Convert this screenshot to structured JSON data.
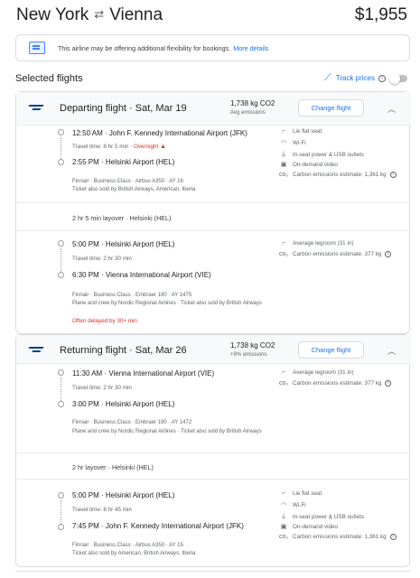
{
  "header": {
    "origin": "New York",
    "swap_glyph": "⇄",
    "destination": "Vienna",
    "total_price": "$1,955"
  },
  "banner": {
    "icon": "flexible-booking-icon",
    "text": "This airline may be offering additional flexibility for bookings.",
    "link": "More details"
  },
  "selected": {
    "title": "Selected flights",
    "track_label": "Track prices",
    "track_enabled": false
  },
  "departing": {
    "title": "Departing flight · Sat, Mar 19",
    "co2": "1,738 kg CO2",
    "co2_sub": "Avg emissions",
    "change_label": "Change flight",
    "segment1": {
      "dep": "12:50 AM · John F. Kennedy International Airport (JFK)",
      "travel": "Travel time: 8 hr 5 min ·",
      "overnight": "Overnight",
      "arr": "2:55 PM · Helsinki Airport (HEL)",
      "info": "Finnair · Business Class · Airbus A350 · AY 16",
      "sold": "Ticket also sold by British Airways, American, Iberia",
      "amenities": [
        "Lie flat seat",
        "Wi-Fi",
        "In-seat power & USB outlets",
        "On-demand video",
        "Carbon emissions estimate: 1,361 kg"
      ]
    },
    "layover": "2 hr 5 min layover · Helsinki (HEL)",
    "segment2": {
      "dep": "5:00 PM · Helsinki Airport (HEL)",
      "travel": "Travel time: 2 hr 30 min",
      "arr": "6:30 PM · Vienna International Airport (VIE)",
      "info": "Finnair · Business Class · Embraer 190 · AY 1475",
      "sold": "Plane and crew by Nordic Regional Airlines · Ticket also sold by British Airways",
      "delay": "Often delayed by 30+ min",
      "amenities": [
        "Average legroom (31 in)",
        "Carbon emissions estimate: 377 kg"
      ]
    }
  },
  "returning": {
    "title": "Returning flight · Sat, Mar 26",
    "co2": "1,738 kg CO2",
    "co2_sub": "+9% emissions",
    "change_label": "Change flight",
    "segment1": {
      "dep": "11:30 AM · Vienna International Airport (VIE)",
      "travel": "Travel time: 2 hr 30 min",
      "arr": "3:00 PM · Helsinki Airport (HEL)",
      "info": "Finnair · Business Class · Embraer 190 · AY 1472",
      "sold": "Plane and crew by Nordic Regional Airlines · Ticket also sold by British Airways",
      "amenities": [
        "Average legroom (31 in)",
        "Carbon emissions estimate: 377 kg"
      ]
    },
    "layover": "2 hr layover · Helsinki (HEL)",
    "segment2": {
      "dep": "5:00 PM · Helsinki Airport (HEL)",
      "travel": "Travel time: 8 hr 45 min",
      "arr": "7:45 PM · John F. Kennedy International Airport (JFK)",
      "info": "Finnair · Business Class · Airbus A350 · AY 15",
      "sold": "Ticket also sold by American, British Airways, Iberia",
      "amenities": [
        "Lie flat seat",
        "Wi-Fi",
        "In-seat power & USB outlets",
        "On-demand video",
        "Carbon emissions estimate: 1,361 kg"
      ]
    }
  },
  "colors": {
    "accent": "#1a73e8",
    "warning": "#d93025",
    "airline": "#0b3d91"
  }
}
